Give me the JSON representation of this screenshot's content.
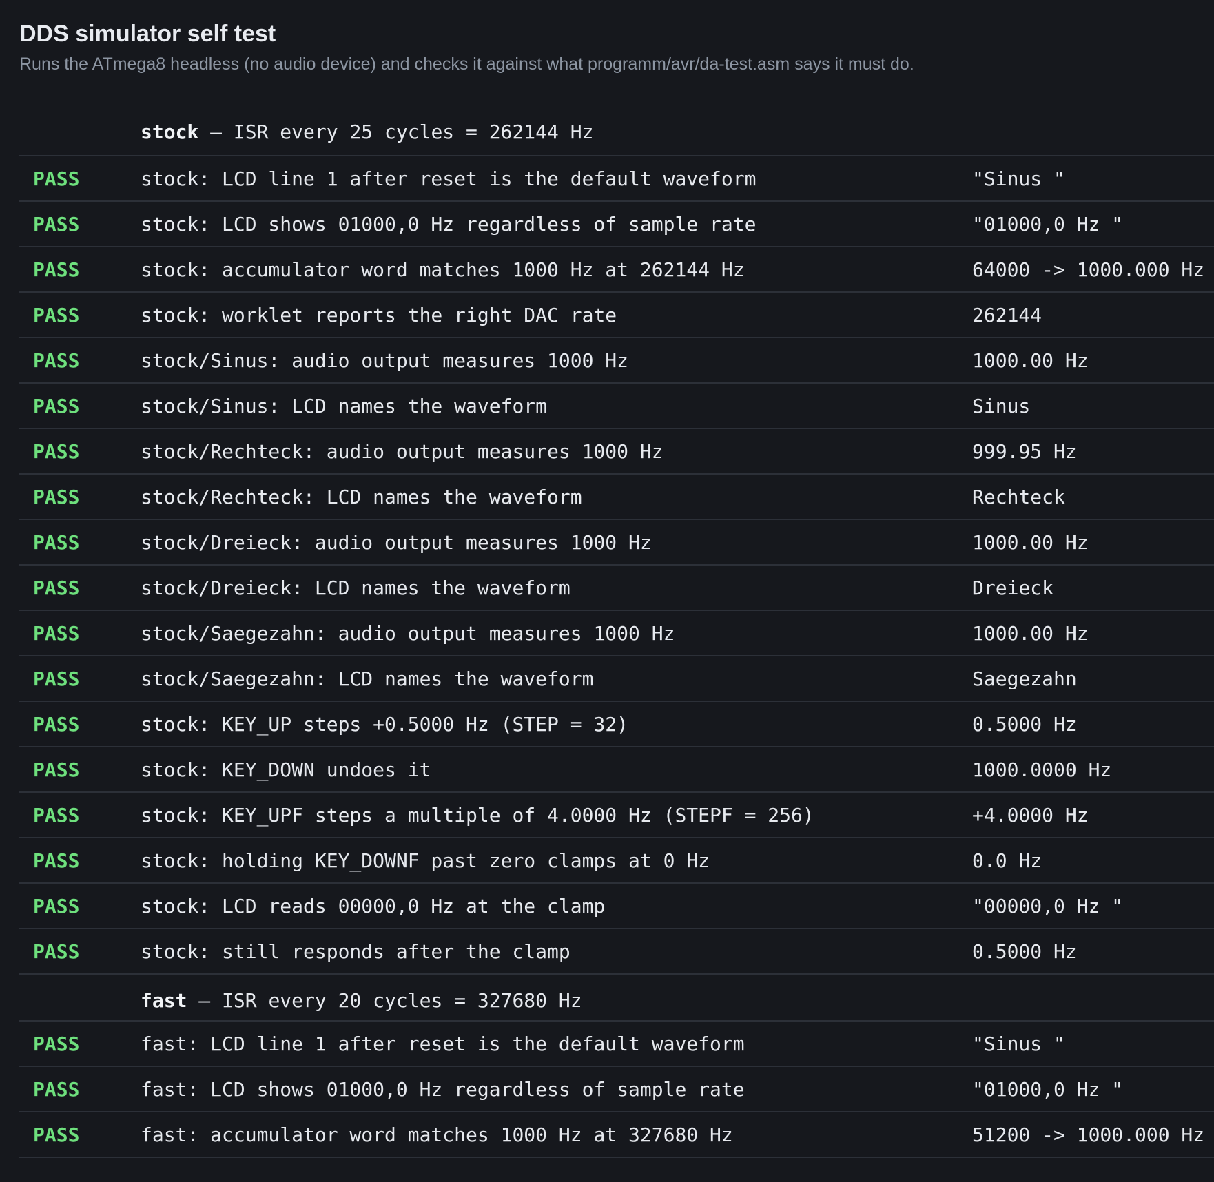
{
  "header": {
    "title": "DDS simulator self test",
    "subtitle": "Runs the ATmega8 headless (no audio device) and checks it against what programm/avr/da-test.asm says it must do."
  },
  "colors": {
    "background": "#16181d",
    "pass": "#6ee07d",
    "divider": "#2c3038",
    "subtitle": "#8d96a3"
  },
  "sections": [
    {
      "name": "stock",
      "detail": " — ISR every 25 cycles = 262144 Hz",
      "rows": [
        {
          "status": "PASS",
          "description": "stock: LCD line 1 after reset is the default waveform",
          "value": "\"Sinus \""
        },
        {
          "status": "PASS",
          "description": "stock: LCD shows 01000,0 Hz regardless of sample rate",
          "value": "\"01000,0 Hz \""
        },
        {
          "status": "PASS",
          "description": "stock: accumulator word matches 1000 Hz at 262144 Hz",
          "value": "64000 -> 1000.000 Hz"
        },
        {
          "status": "PASS",
          "description": "stock: worklet reports the right DAC rate",
          "value": "262144"
        },
        {
          "status": "PASS",
          "description": "stock/Sinus: audio output measures 1000 Hz",
          "value": "1000.00 Hz"
        },
        {
          "status": "PASS",
          "description": "stock/Sinus: LCD names the waveform",
          "value": "Sinus"
        },
        {
          "status": "PASS",
          "description": "stock/Rechteck: audio output measures 1000 Hz",
          "value": "999.95 Hz"
        },
        {
          "status": "PASS",
          "description": "stock/Rechteck: LCD names the waveform",
          "value": "Rechteck"
        },
        {
          "status": "PASS",
          "description": "stock/Dreieck: audio output measures 1000 Hz",
          "value": "1000.00 Hz"
        },
        {
          "status": "PASS",
          "description": "stock/Dreieck: LCD names the waveform",
          "value": "Dreieck"
        },
        {
          "status": "PASS",
          "description": "stock/Saegezahn: audio output measures 1000 Hz",
          "value": "1000.00 Hz"
        },
        {
          "status": "PASS",
          "description": "stock/Saegezahn: LCD names the waveform",
          "value": "Saegezahn"
        },
        {
          "status": "PASS",
          "description": "stock: KEY_UP steps +0.5000 Hz (STEP = 32)",
          "value": "0.5000 Hz"
        },
        {
          "status": "PASS",
          "description": "stock: KEY_DOWN undoes it",
          "value": "1000.0000 Hz"
        },
        {
          "status": "PASS",
          "description": "stock: KEY_UPF steps a multiple of 4.0000 Hz (STEPF = 256)",
          "value": "+4.0000 Hz"
        },
        {
          "status": "PASS",
          "description": "stock: holding KEY_DOWNF past zero clamps at 0 Hz",
          "value": "0.0 Hz"
        },
        {
          "status": "PASS",
          "description": "stock: LCD reads 00000,0 Hz at the clamp",
          "value": "\"00000,0 Hz \""
        },
        {
          "status": "PASS",
          "description": "stock: still responds after the clamp",
          "value": "0.5000 Hz"
        }
      ]
    },
    {
      "name": "fast",
      "detail": " — ISR every 20 cycles = 327680 Hz",
      "rows": [
        {
          "status": "PASS",
          "description": "fast: LCD line 1 after reset is the default waveform",
          "value": "\"Sinus \""
        },
        {
          "status": "PASS",
          "description": "fast: LCD shows 01000,0 Hz regardless of sample rate",
          "value": "\"01000,0 Hz \""
        },
        {
          "status": "PASS",
          "description": "fast: accumulator word matches 1000 Hz at 327680 Hz",
          "value": "51200 -> 1000.000 Hz"
        }
      ]
    }
  ]
}
